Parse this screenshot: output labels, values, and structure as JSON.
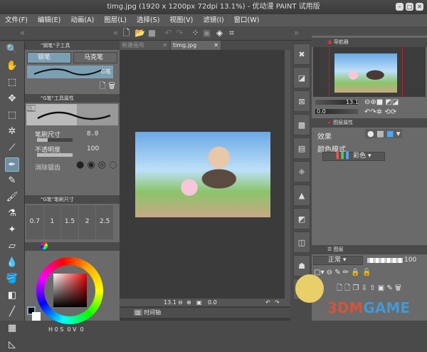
{
  "window": {
    "title": "timg.jpg (1920 x 1200px 72dpi 13.1%)  - 优动漫 PAINT 试用版"
  },
  "menu": [
    "文件(F)",
    "编辑(E)",
    "动画(A)",
    "图层(L)",
    "选择(S)",
    "视图(V)",
    "滤镜(I)",
    "窗口(W)"
  ],
  "subtool": {
    "header": "\"钢笔\"子工具",
    "tabs": [
      "钢笔",
      "马克笔"
    ],
    "brush_name": "G笔"
  },
  "tool_property": {
    "header": "\"G笔\"工具属性",
    "preview_label": "G笔",
    "brush_size_label": "笔刷尺寸",
    "brush_size": "8.0",
    "opacity_label": "不透明度",
    "opacity": "100",
    "opacity_value": 100,
    "aa_label": "消除锯齿"
  },
  "brush_size_panel": {
    "header": "\"G笔\"笔刷尺寸",
    "sizes": [
      "0.7",
      "1",
      "1.5",
      "2",
      "2.5"
    ]
  },
  "color": {
    "h_label": "H",
    "h": "0",
    "s_label": "S",
    "s": "0",
    "v_label": "V",
    "v": "0",
    "fg": "#000000",
    "bg": "#ffffff"
  },
  "canvas": {
    "tabs": [
      "新建画布",
      "timg.jpg"
    ],
    "active_tab": 1,
    "zoom": "13.1",
    "rotation": "0.0",
    "timeline_label": "时间轴"
  },
  "navigator": {
    "tab": "导航器",
    "zoom": "13.1",
    "rotation": "0.0"
  },
  "layer_property": {
    "tab": "图层属性",
    "effect_label": "效果",
    "color_mode_label": "颜色模式",
    "color_mode": "彩色"
  },
  "layers": {
    "tab": "图层",
    "blend_mode": "正常",
    "opacity": "100"
  },
  "watermark": "3DMGAME",
  "colors": {
    "accent": "#6f8ea3"
  }
}
